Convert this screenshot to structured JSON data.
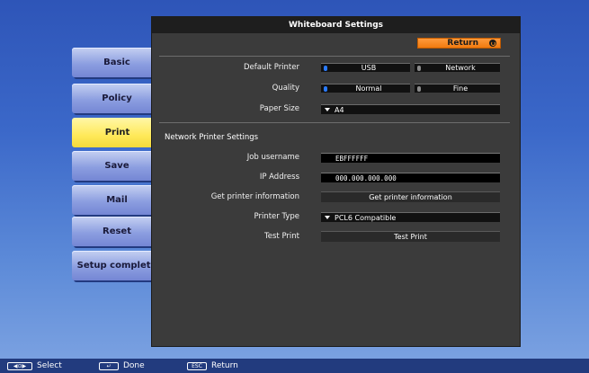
{
  "panel": {
    "title": "Whiteboard Settings",
    "return_label": "Return"
  },
  "sidebar": {
    "items": [
      {
        "label": "Basic"
      },
      {
        "label": "Policy"
      },
      {
        "label": "Print"
      },
      {
        "label": "Save"
      },
      {
        "label": "Mail"
      },
      {
        "label": "Reset"
      },
      {
        "label": "Setup complete"
      }
    ],
    "active": "Print"
  },
  "settings": {
    "default_printer": {
      "label": "Default Printer",
      "options": [
        "USB",
        "Network"
      ],
      "selected": "USB"
    },
    "quality": {
      "label": "Quality",
      "options": [
        "Normal",
        "Fine"
      ],
      "selected": "Normal"
    },
    "paper_size": {
      "label": "Paper Size",
      "value": "A4"
    }
  },
  "network": {
    "section_title": "Network Printer Settings",
    "job_username": {
      "label": "Job username",
      "value": "EBFFFFFF"
    },
    "ip_address": {
      "label": "IP Address",
      "value": "000.000.000.000"
    },
    "get_info": {
      "label": "Get printer information",
      "button": "Get printer information"
    },
    "printer_type": {
      "label": "Printer Type",
      "value": "PCL6 Compatible"
    },
    "test_print": {
      "label": "Test Print",
      "button": "Test Print"
    }
  },
  "statusbar": {
    "select": {
      "key": "◀⊙▶",
      "label": "Select"
    },
    "done": {
      "key": "↵",
      "label": "Done"
    },
    "return": {
      "key": "ESC",
      "label": "Return"
    }
  },
  "colors": {
    "accent": "#f07a10",
    "active_tab": "#ffe95a",
    "panel_bg": "#3b3b3b",
    "radio_on": "#2a7bff"
  }
}
